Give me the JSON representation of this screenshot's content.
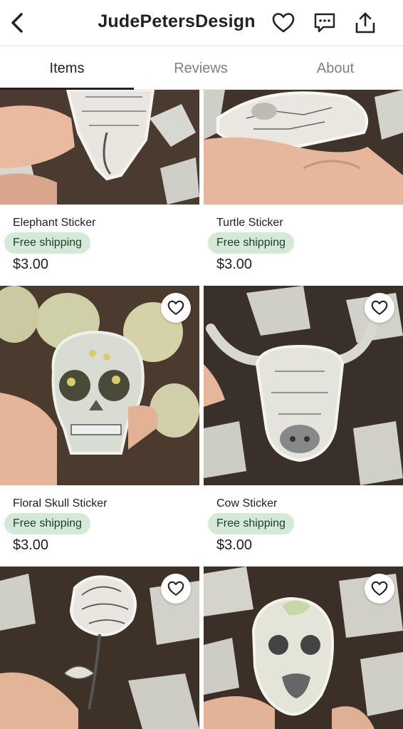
{
  "header": {
    "title": "JudePetersDesign",
    "icons": [
      "back-arrow-icon",
      "heart-icon",
      "message-icon",
      "share-icon"
    ]
  },
  "tabs": [
    {
      "label": "Items",
      "active": true
    },
    {
      "label": "Reviews",
      "active": false
    },
    {
      "label": "About",
      "active": false
    }
  ],
  "listings": [
    {
      "title": "Elephant Sticker",
      "shipping": "Free shipping",
      "price": "$3.00"
    },
    {
      "title": "Turtle Sticker",
      "shipping": "Free shipping",
      "price": "$3.00"
    },
    {
      "title": "Floral Skull Sticker",
      "shipping": "Free shipping",
      "price": "$3.00"
    },
    {
      "title": "Cow Sticker",
      "shipping": "Free shipping",
      "price": "$3.00"
    },
    {
      "title": "",
      "shipping": "",
      "price": ""
    },
    {
      "title": "",
      "shipping": "",
      "price": ""
    }
  ],
  "colors": {
    "badge_bg": "#d4e9d7",
    "badge_text": "#1f3d26",
    "active_tab": "#222222",
    "inactive_tab": "#808080"
  }
}
